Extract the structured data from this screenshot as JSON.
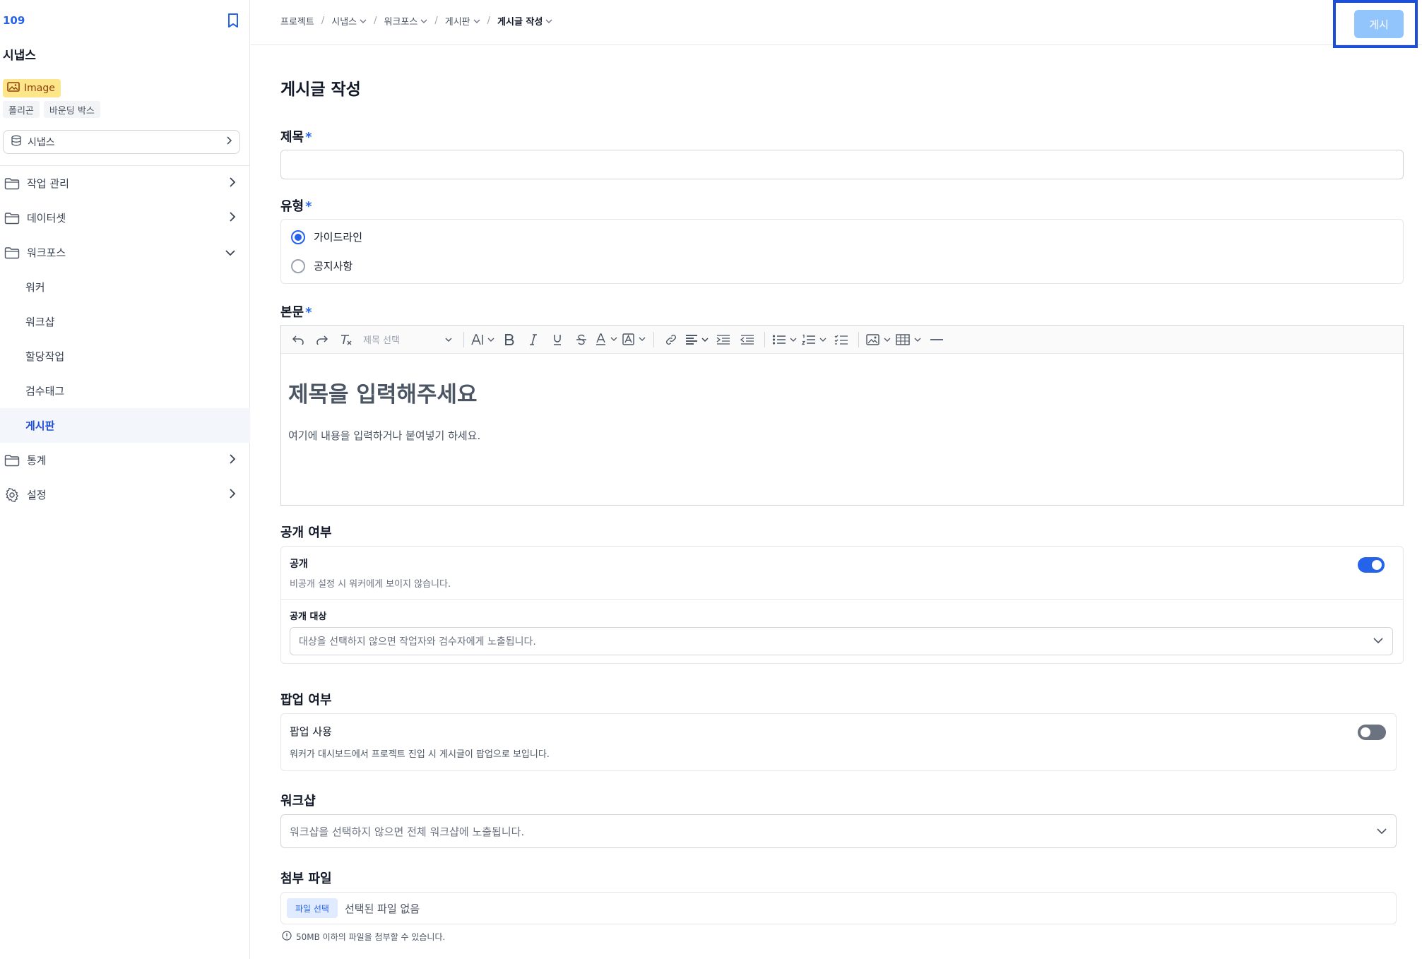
{
  "sidebar": {
    "project_id": "109",
    "project_name": "시냅스",
    "image_badge": "Image",
    "tags": [
      "폴리곤",
      "바운딩 박스"
    ],
    "selector_label": "시냅스",
    "nav": [
      {
        "label": "작업 관리",
        "icon": "folder-icon",
        "expanded": false
      },
      {
        "label": "데이터셋",
        "icon": "folder-icon",
        "expanded": false
      },
      {
        "label": "워크포스",
        "icon": "folder-icon",
        "expanded": true
      }
    ],
    "workforce_sub": [
      "워커",
      "워크샵",
      "할당작업",
      "검수태그",
      "게시판"
    ],
    "active_sub": "게시판",
    "nav_bottom": [
      {
        "label": "통계",
        "icon": "folder-icon"
      },
      {
        "label": "설정",
        "icon": "gear-icon"
      }
    ]
  },
  "breadcrumb": [
    "프로젝트",
    "시냅스",
    "워크포스",
    "게시판",
    "게시글 작성"
  ],
  "publish_label": "게시",
  "page_title": "게시글 작성",
  "form": {
    "title_label": "제목",
    "required_mark": "*",
    "type_label": "유형",
    "type_options": [
      "가이드라인",
      "공지사항"
    ],
    "type_selected": "가이드라인",
    "body_label": "본문",
    "heading_select_placeholder": "제목 선택",
    "editor_heading_placeholder": "제목을 입력해주세요",
    "editor_body_placeholder": "여기에 내용을 입력하거나 붙여넣기 하세요.",
    "visibility_section": "공개 여부",
    "visibility_title": "공개",
    "visibility_desc": "비공개 설정 시 워커에게 보이지 않습니다.",
    "visibility_on": true,
    "target_label": "공개 대상",
    "target_placeholder": "대상을 선택하지 않으면 작업자와 검수자에게 노출됩니다.",
    "popup_section": "팝업 여부",
    "popup_title": "팝업 사용",
    "popup_desc": "워커가 대시보드에서 프로젝트 진입 시 게시글이 팝업으로 보입니다.",
    "popup_on": false,
    "workshop_section": "워크샵",
    "workshop_placeholder": "워크샵을 선택하지 않으면 전체 워크샵에 노출됩니다.",
    "attach_section": "첨부 파일",
    "file_button": "파일 선택",
    "file_none": "선택된 파일 없음",
    "file_hint": "50MB 이하의 파일을 첨부할 수 있습니다."
  },
  "colors": {
    "accent": "#2563eb",
    "publish_disabled": "#93c5fd",
    "badge": "#fde68a",
    "highlight_frame": "#1d4ed8"
  }
}
